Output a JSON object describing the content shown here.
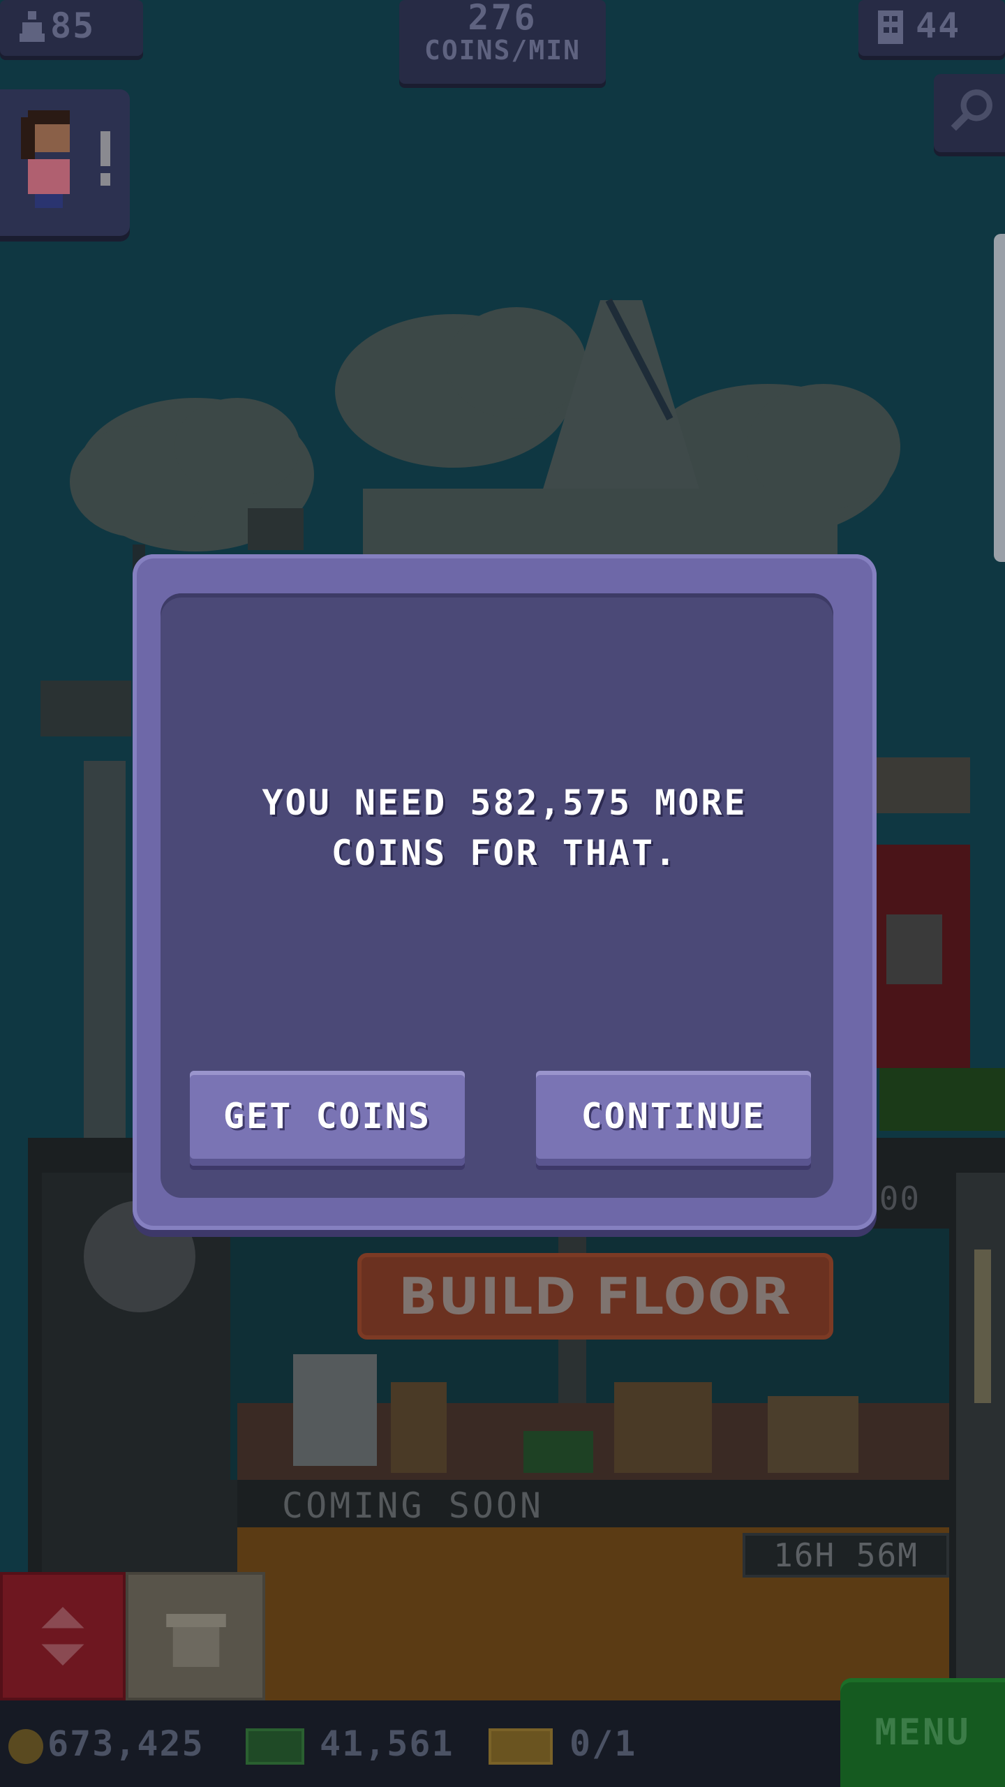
{
  "hud": {
    "population": "85",
    "coins_rate": "276",
    "coins_rate_label": "COINS/MIN",
    "floors": "44",
    "search_icon": "magnifier-icon"
  },
  "tower": {
    "build_floor_label": "BUILD FLOOR",
    "coming_soon_label": "COMING SOON",
    "timer": "16H 56M",
    "counter_fragment": "000"
  },
  "dialog": {
    "message_line1": "YOU NEED 582,575 MORE",
    "message_line2": "COINS FOR THAT.",
    "get_coins_label": "GET COINS",
    "continue_label": "CONTINUE"
  },
  "bottom_bar": {
    "coins": "673,425",
    "bux": "41,561",
    "tickets": "0/1",
    "menu_label": "MENU"
  },
  "colors": {
    "sky": "#0f3742",
    "dialog_frame": "#6e68a8",
    "dialog_inner": "#4b4977",
    "button": "#7a74b4",
    "menu_green": "#155a20",
    "build_floor_orange": "#6b3120"
  }
}
